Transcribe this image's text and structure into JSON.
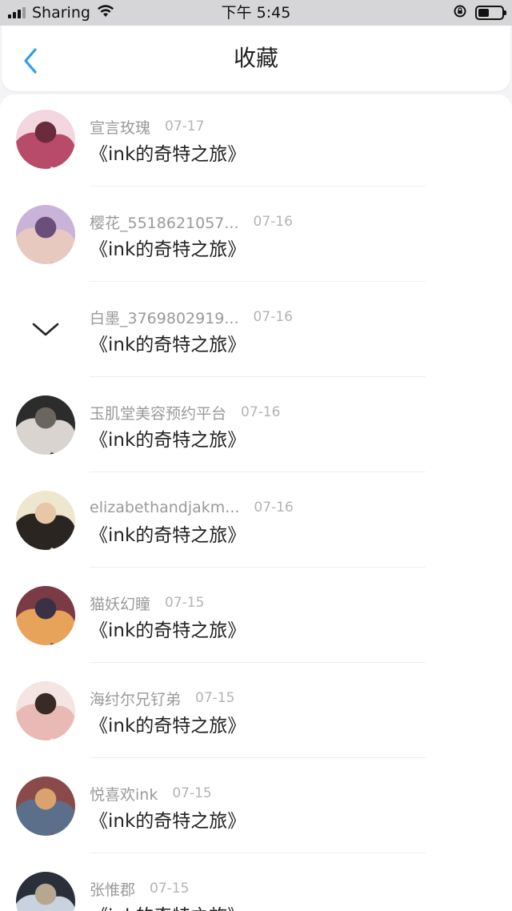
{
  "status_bar": {
    "carrier": "Sharing",
    "time": "下午 5:45",
    "icons": [
      "signal-icon",
      "wifi-icon",
      "rotation-lock-icon",
      "battery-icon"
    ],
    "battery_level": 0.45
  },
  "nav": {
    "back_icon": "chevron-left-icon",
    "title": "收藏",
    "accent": "#2f9cf0"
  },
  "items": [
    {
      "username": "宣言玫瑰",
      "date": "07-17",
      "title": "《ink的奇特之旅》",
      "avatar_colors": [
        "#f3d6df",
        "#b84a6a",
        "#6a2c3c"
      ]
    },
    {
      "username": "樱花_5518621057...",
      "date": "07-16",
      "title": "《ink的奇特之旅》",
      "avatar_colors": [
        "#c9b3d8",
        "#e7c9c0",
        "#6b4e7a"
      ]
    },
    {
      "username": "白墨_3769802919...",
      "date": "07-16",
      "title": "《ink的奇特之旅》",
      "avatar_icon": "chevron-down-icon"
    },
    {
      "username": "玉肌堂美容预约平台",
      "date": "07-16",
      "title": "《ink的奇特之旅》",
      "avatar_colors": [
        "#2c2c2c",
        "#d9d4cf",
        "#6b6560"
      ]
    },
    {
      "username": "elizabethandjakm...",
      "date": "07-16",
      "title": "《ink的奇特之旅》",
      "avatar_colors": [
        "#efe6cf",
        "#2a2520",
        "#e8c7a8"
      ]
    },
    {
      "username": "猫妖幻瞳",
      "date": "07-15",
      "title": "《ink的奇特之旅》",
      "avatar_colors": [
        "#7a3b46",
        "#e8a35a",
        "#3b3147"
      ]
    },
    {
      "username": "海纣尔兄钌弟",
      "date": "07-15",
      "title": "《ink的奇特之旅》",
      "avatar_colors": [
        "#f4e4e2",
        "#e8b9b5",
        "#3a2a26"
      ]
    },
    {
      "username": "悦喜欢ink",
      "date": "07-15",
      "title": "《ink的奇特之旅》",
      "avatar_colors": [
        "#8a4a4a",
        "#5b6f8a",
        "#d9a26e"
      ]
    },
    {
      "username": "张惟郡",
      "date": "07-15",
      "title": "《ink的奇特之旅》",
      "avatar_colors": [
        "#2a2f3a",
        "#c9d3e0",
        "#b8a790"
      ]
    }
  ]
}
